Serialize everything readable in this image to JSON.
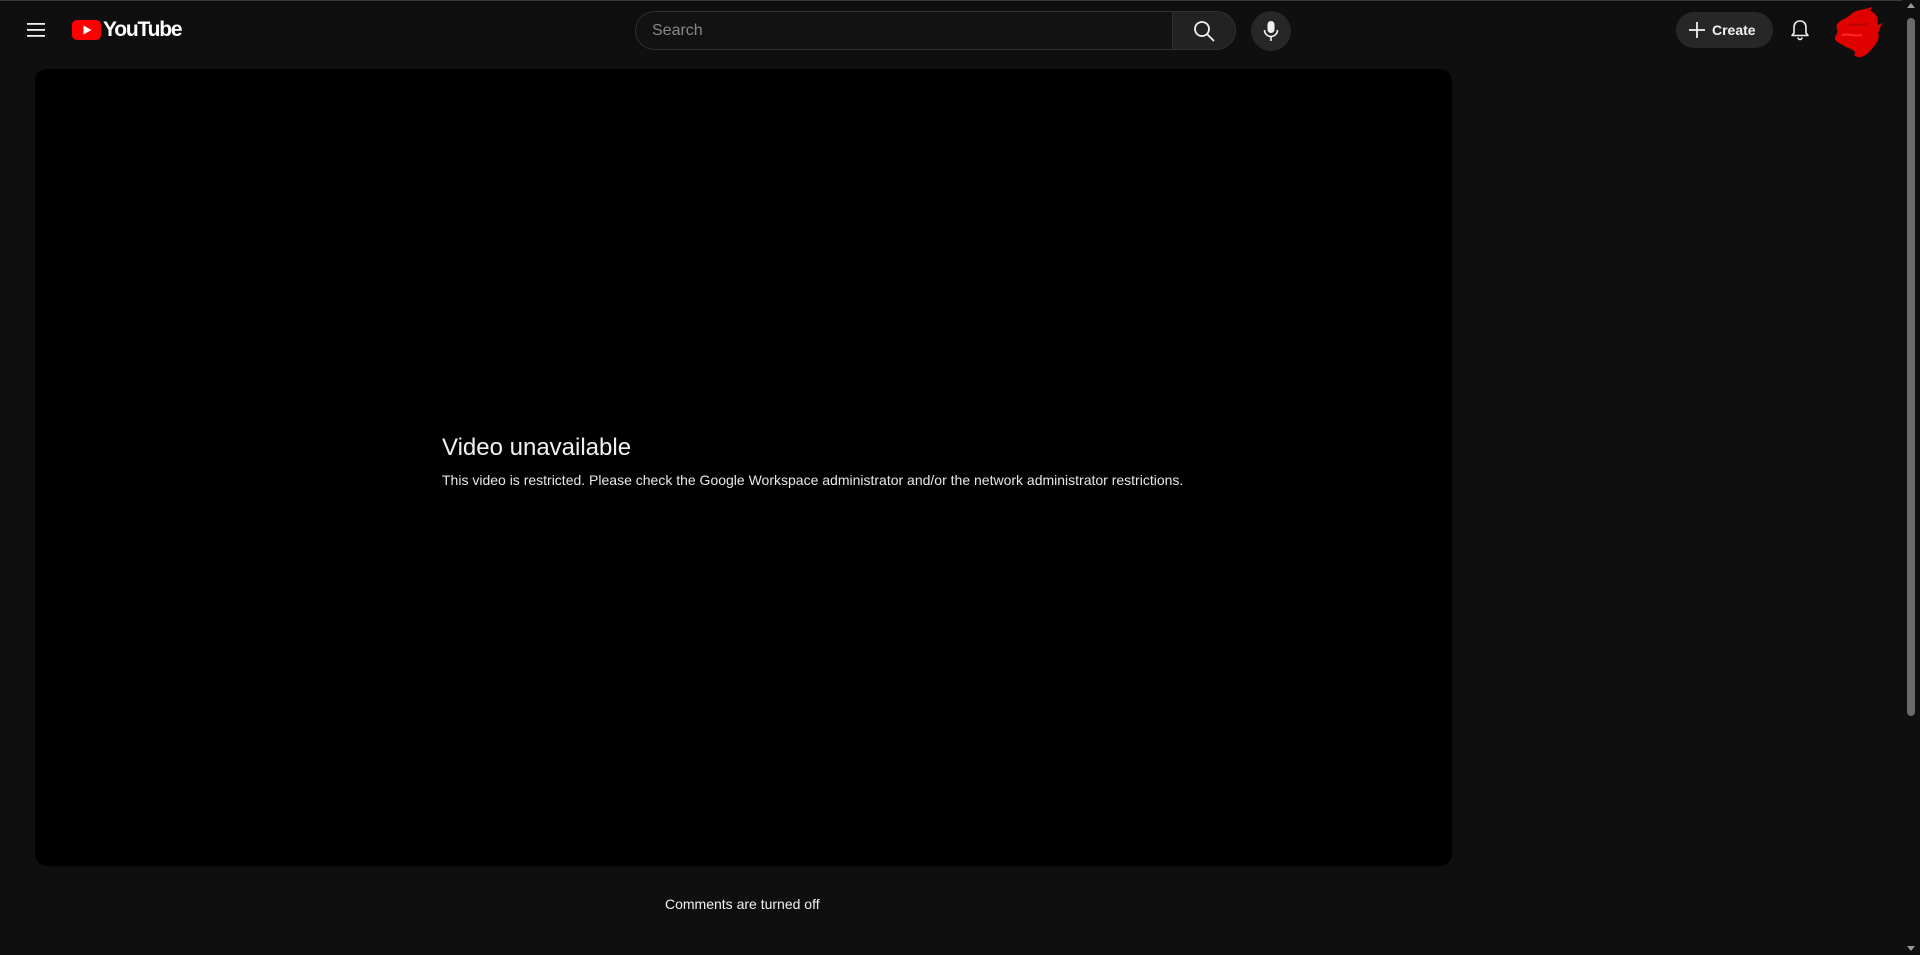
{
  "header": {
    "logo_text": "YouTube",
    "search": {
      "placeholder": "Search",
      "value": ""
    },
    "create_label": "Create"
  },
  "player": {
    "error_title": "Video unavailable",
    "error_message": "This video is restricted. Please check the Google Workspace administrator and/or the network administrator restrictions."
  },
  "comments": {
    "status": "Comments are turned off"
  },
  "colors": {
    "background": "#0f0f0f",
    "player_background": "#000000",
    "brand_red": "#ff0000",
    "button_bg": "#272727",
    "avatar_color": "#e00000"
  },
  "icons": {
    "menu": "hamburger-menu-icon",
    "logo": "youtube-play-icon",
    "search": "search-icon",
    "mic": "microphone-icon",
    "create": "plus-icon",
    "notifications": "bell-icon",
    "avatar": "avatar-scribble"
  }
}
